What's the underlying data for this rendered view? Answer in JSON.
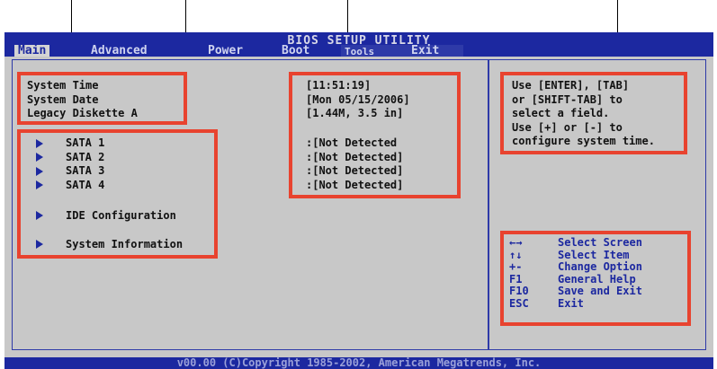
{
  "title": "BIOS SETUP UTILITY",
  "menu": {
    "main": "Main",
    "advanced": "Advanced",
    "power": "Power",
    "boot": "Boot",
    "tools": "Tools",
    "exit": "Exit"
  },
  "fields": {
    "system_time_label": "System Time",
    "system_date_label": "System Date",
    "legacy_diskette_label": "Legacy Diskette A",
    "system_time_value": "[11:51:19]",
    "system_date_value": "[Mon 05/15/2006]",
    "legacy_diskette_value": "[1.44M, 3.5 in]"
  },
  "submenus": [
    {
      "label": "SATA 1",
      "value": ":[Not Detected"
    },
    {
      "label": "SATA 2",
      "value": ":[Not Detected]"
    },
    {
      "label": "SATA 3",
      "value": ":[Not Detected]"
    },
    {
      "label": "SATA 4",
      "value": ":[Not Detected]"
    },
    {
      "label": "IDE Configuration"
    },
    {
      "label": "System Information"
    }
  ],
  "help": {
    "line1": "Use [ENTER], [TAB]",
    "line2": "or [SHIFT-TAB] to",
    "line3": "select a field.",
    "line4": "Use [+] or [-] to",
    "line5": "configure system time."
  },
  "keys": [
    {
      "key": "←→",
      "desc": "Select Screen"
    },
    {
      "key": "↑↓",
      "desc": "Select Item"
    },
    {
      "key": "+-",
      "desc": "Change Option"
    },
    {
      "key": "F1",
      "desc": "General Help"
    },
    {
      "key": "F10",
      "desc": "Save and Exit"
    },
    {
      "key": "ESC",
      "desc": "Exit"
    }
  ],
  "footer": "v00.00 (C)Copyright 1985-2002, American Megatrends, Inc.",
  "colors": {
    "menubar": "#1c28a0",
    "panel": "#c8c8c8",
    "callout": "#e8432f"
  }
}
